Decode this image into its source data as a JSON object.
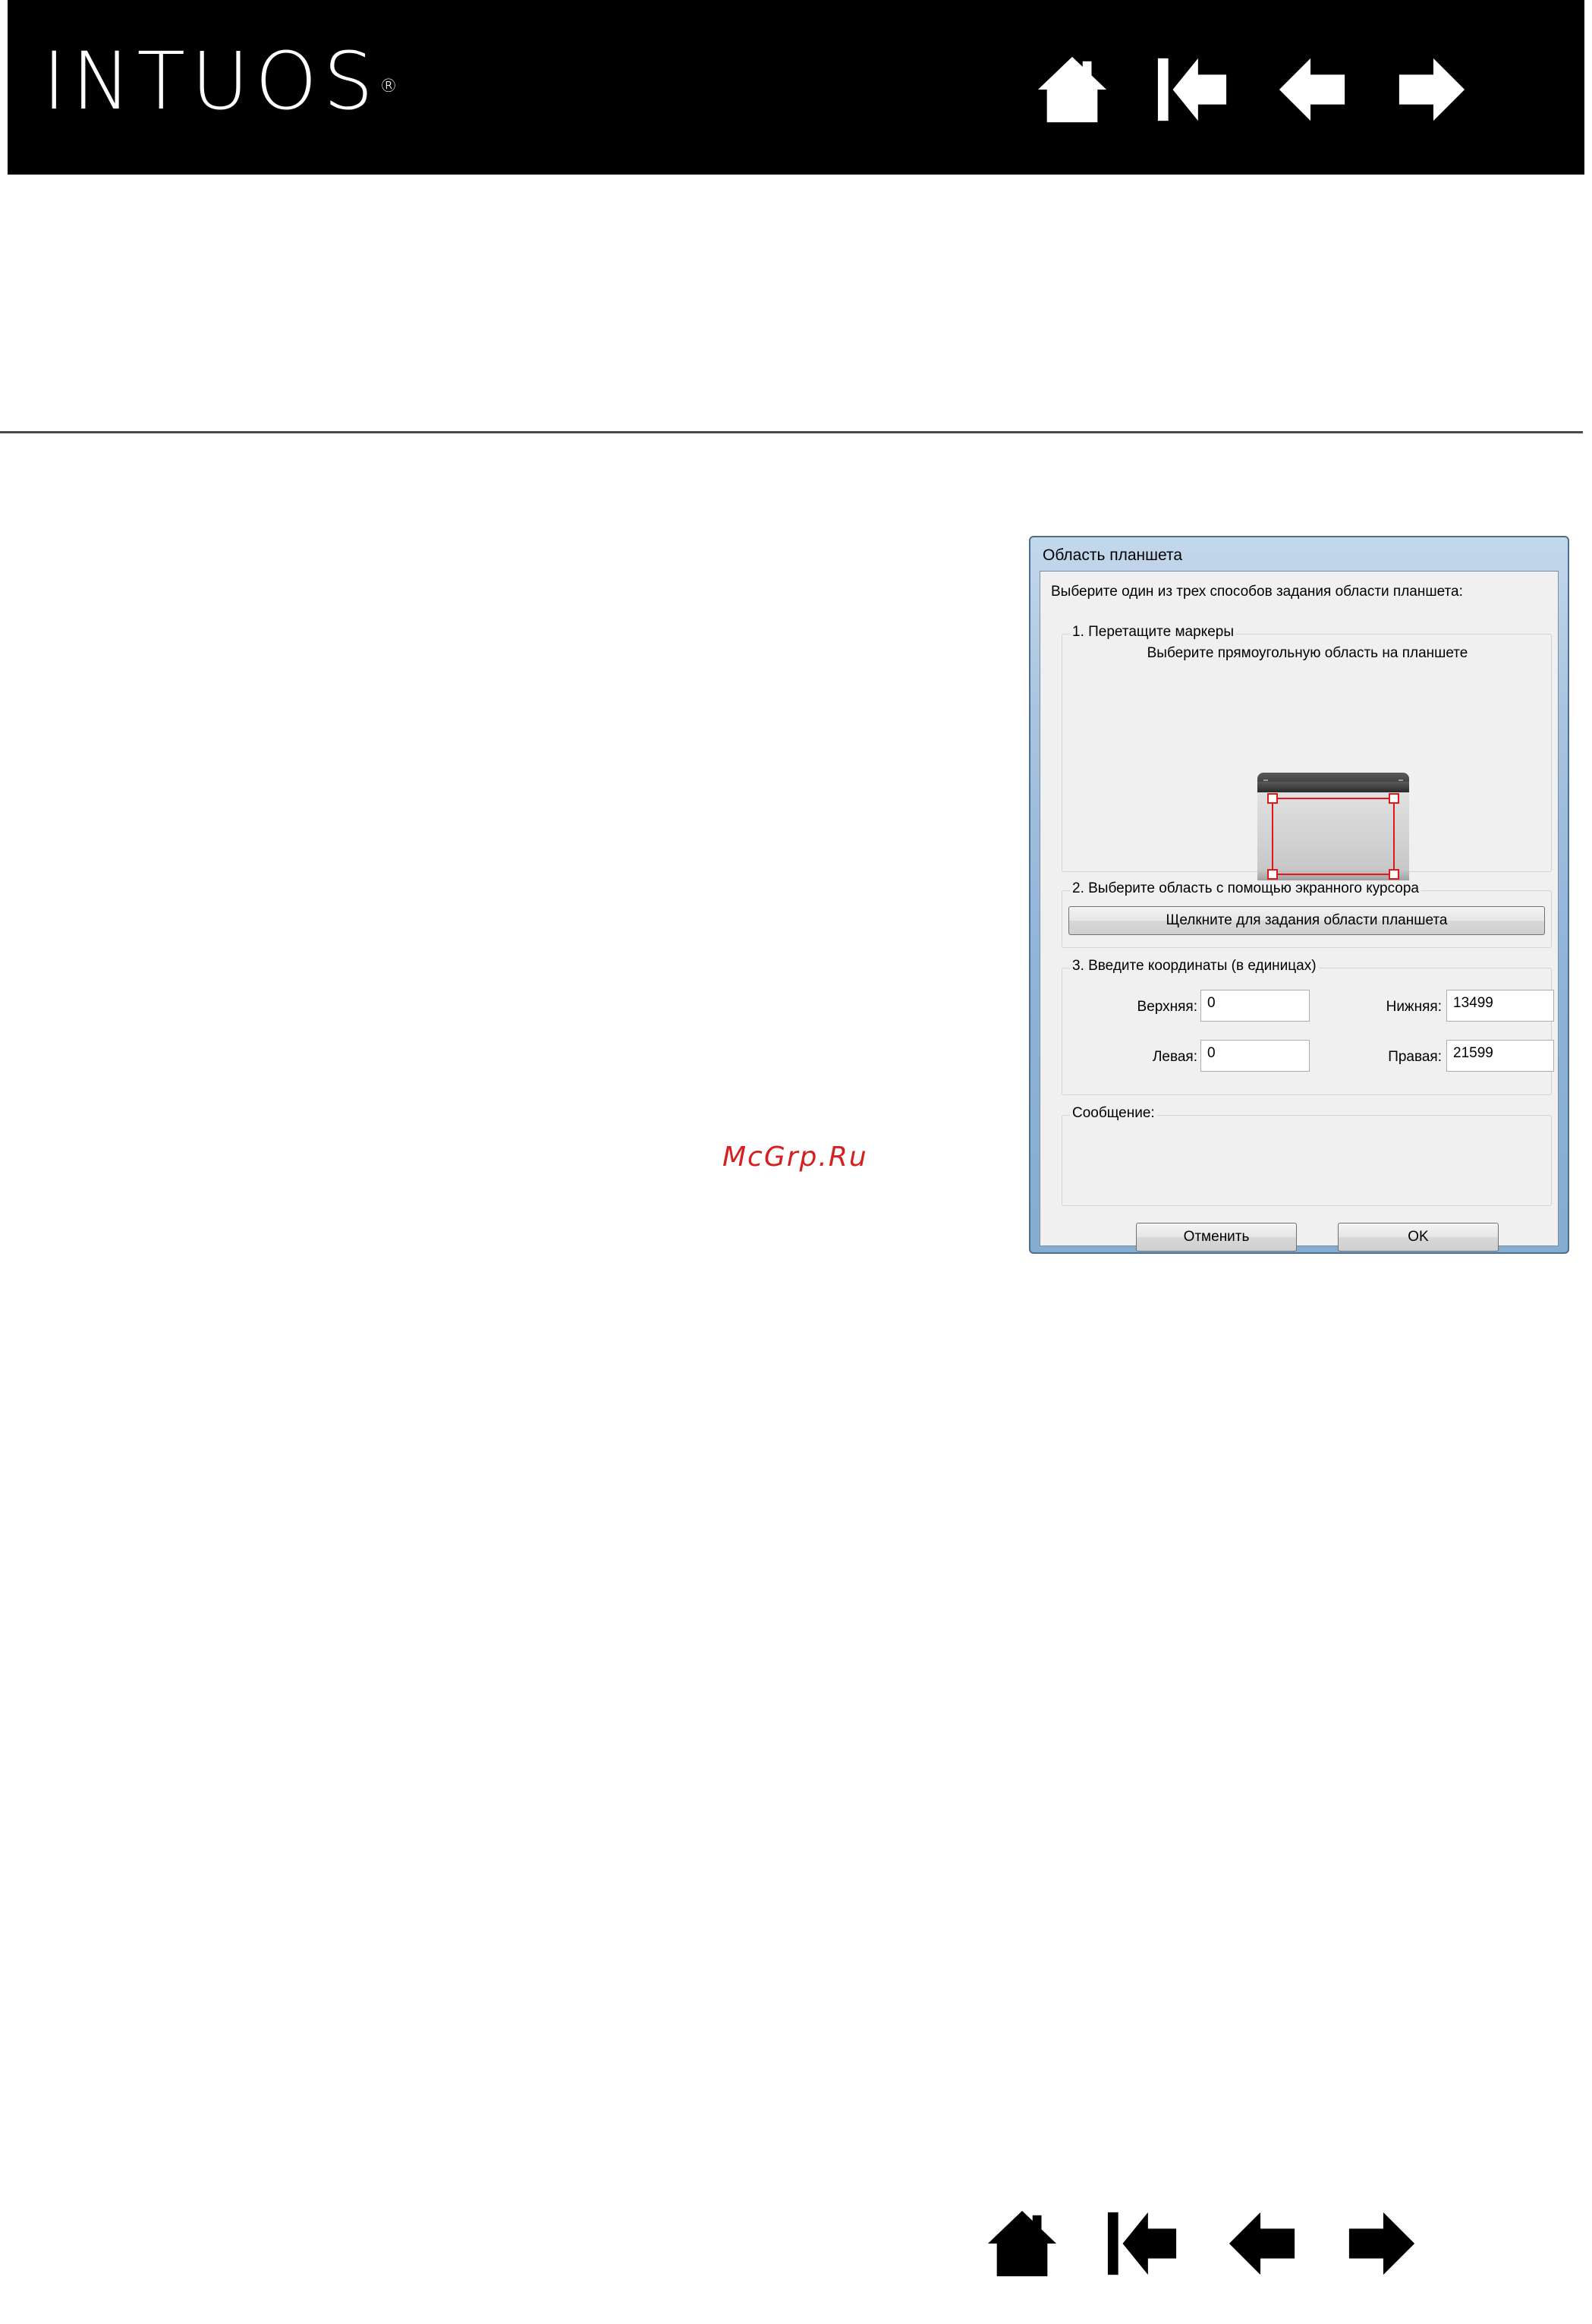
{
  "header": {
    "logo": "INTUOS",
    "logo_mark": "®"
  },
  "nav": {
    "icons": [
      "home-icon",
      "first-page-icon",
      "previous-page-icon",
      "next-page-icon"
    ]
  },
  "watermark": "McGrp.Ru",
  "dialog": {
    "title": "Область планшета",
    "instruction": "Выберите один из трех способов задания области планшета:",
    "group1": {
      "legend": "1. Перетащите маркеры",
      "hint": "Выберите прямоугольную область на планшете"
    },
    "group2": {
      "legend": "2. Выберите область с помощью экранного курсора",
      "button": "Щелкните для задания области планшета"
    },
    "group3": {
      "legend": "3. Введите координаты (в единицах)",
      "top_label": "Верхняя:",
      "top_value": "0",
      "bottom_label": "Нижняя:",
      "bottom_value": "13499",
      "left_label": "Левая:",
      "left_value": "0",
      "right_label": "Правая:",
      "right_value": "21599"
    },
    "message_legend": "Сообщение:",
    "cancel_button": "Отменить",
    "ok_button": "OK"
  },
  "colors": {
    "header_bg": "#000000",
    "marker_red": "#e01818",
    "watermark_red": "#d62020"
  }
}
